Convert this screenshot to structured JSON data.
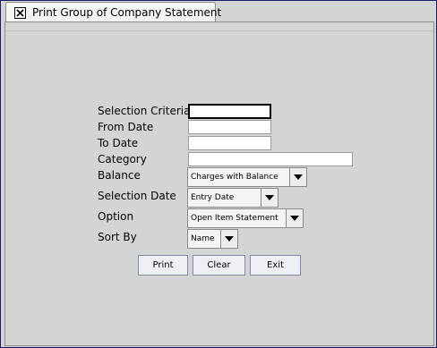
{
  "window": {
    "tab_title": "Print Group of Company Statement",
    "close_icon": "close-x-box-icon"
  },
  "form": {
    "selection_criteria_label": "Selection Criteria",
    "selection_criteria_value": "",
    "from_date_label": "From Date",
    "from_date_value": "",
    "to_date_label": "To Date",
    "to_date_value": "",
    "category_label": "Category",
    "category_value": "",
    "balance_label": "Balance",
    "balance_value": "Charges with Balance",
    "selection_date_label": "Selection Date",
    "selection_date_value": "Entry Date",
    "option_label": "Option",
    "option_value": "Open Item Statement",
    "sort_by_label": "Sort By",
    "sort_by_value": "Name"
  },
  "buttons": {
    "print": "Print",
    "clear": "Clear",
    "exit": "Exit"
  }
}
